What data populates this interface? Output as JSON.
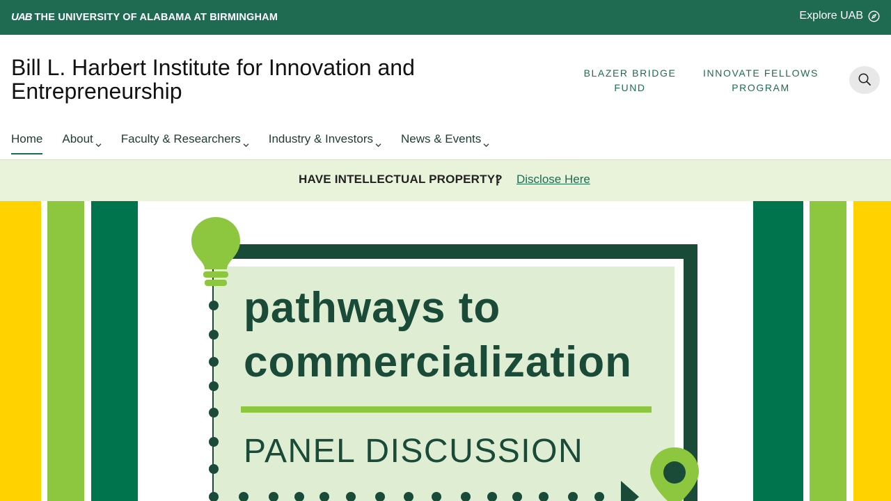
{
  "topbar": {
    "logo_mark": "UAB",
    "logo_name": "THE UNIVERSITY OF ALABAMA AT BIRMINGHAM",
    "explore_label": "Explore UAB"
  },
  "header": {
    "site_title": "Bill L. Harbert Institute for Innovation and Entrepreneurship",
    "quick_links": [
      {
        "label": "BLAZER BRIDGE FUND"
      },
      {
        "label": "INNOVATE FELLOWS PROGRAM"
      }
    ]
  },
  "nav": {
    "items": [
      {
        "label": "Home",
        "active": true,
        "dropdown": false
      },
      {
        "label": "About",
        "active": false,
        "dropdown": true
      },
      {
        "label": "Faculty & Researchers",
        "active": false,
        "dropdown": true
      },
      {
        "label": "Industry & Investors",
        "active": false,
        "dropdown": true
      },
      {
        "label": "News & Events",
        "active": false,
        "dropdown": true
      }
    ]
  },
  "banner": {
    "prompt": "HAVE INTELLECTUAL PROPERTY?",
    "separator": "|",
    "link_label": "Disclose Here"
  },
  "hero": {
    "line1": "pathways to",
    "line2": "commercialization",
    "line3": "PANEL DISCUSSION"
  },
  "colors": {
    "brand_green": "#1e6b52",
    "banner_bg": "#e9f3d9",
    "lime": "#8dc63f",
    "gold": "#ffd200",
    "hero_green": "#00744d",
    "panel_bg": "#dfedd3"
  },
  "icons": [
    "compass-icon",
    "search-icon",
    "chevron-down-icon",
    "lightbulb-icon",
    "map-pin-icon"
  ]
}
